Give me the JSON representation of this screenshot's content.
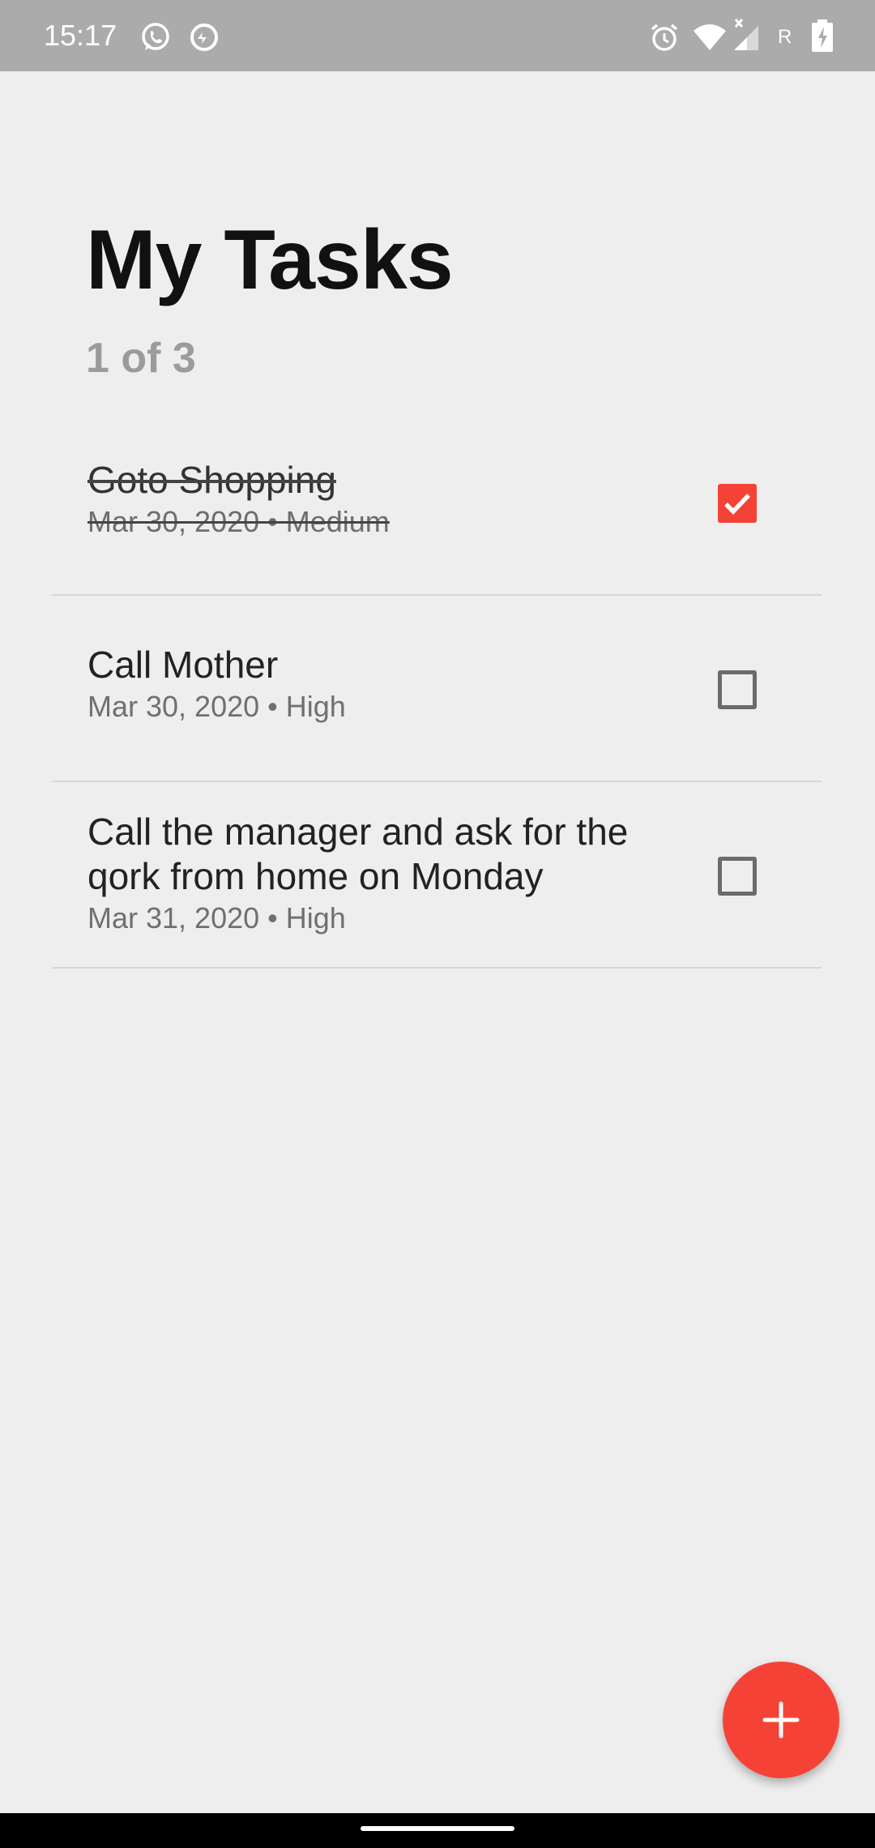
{
  "status_bar": {
    "time": "15:17",
    "left_icons": [
      "whatsapp-icon",
      "data-saver-icon"
    ],
    "right_icons": [
      "alarm-icon",
      "wifi-icon",
      "signal-icon",
      "roaming-icon",
      "battery-charging-icon"
    ],
    "roaming_label": "R"
  },
  "header": {
    "title": "My Tasks",
    "count": "1 of 3"
  },
  "tasks": [
    {
      "title": "Goto Shopping",
      "meta": "Mar 30, 2020 • Medium",
      "done": true
    },
    {
      "title": "Call Mother",
      "meta": "Mar 30, 2020 • High",
      "done": false
    },
    {
      "title": "Call the manager and ask for the qork from home on Monday",
      "meta": "Mar 31, 2020 • High",
      "done": false
    }
  ],
  "fab": {
    "icon": "plus-icon"
  },
  "colors": {
    "accent": "#f44336",
    "background": "#eeeeee",
    "status_bar": "#ababab",
    "title": "#111111",
    "count": "#9b9b9b",
    "meta": "#707070"
  }
}
